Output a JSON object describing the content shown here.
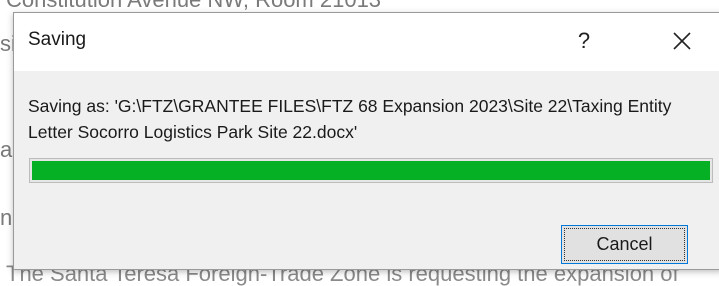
{
  "background": {
    "top_text": "Constitution Avenue NW, Room 21013",
    "left_fragments": [
      "si",
      "a",
      "n"
    ],
    "bottom_text": "The Santa Teresa Foreign-Trade Zone is requesting the expansion of"
  },
  "dialog": {
    "title": "Saving",
    "help_label": "?",
    "close_icon": "close-icon",
    "message": "Saving as: 'G:\\FTZ\\GRANTEE FILES\\FTZ 68 Expansion 2023\\Site 22\\Taxing Entity Letter Socorro Logistics Park Site 22.docx'",
    "progress": 1.0,
    "progress_color": "#06b025",
    "cancel_label": "Cancel",
    "focus_color": "#0078d7"
  }
}
